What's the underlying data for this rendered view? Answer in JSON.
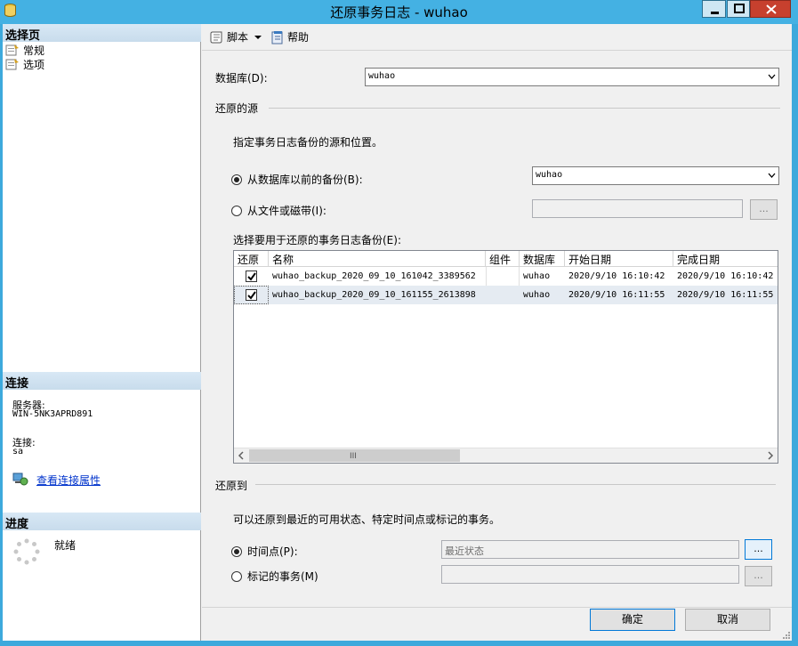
{
  "window": {
    "title": "还原事务日志  -  wuhao",
    "colors": {
      "titlebar": "#44b1e3",
      "close": "#c7402e"
    }
  },
  "left": {
    "select_page_header": "选择页",
    "pages": [
      {
        "label": "常规",
        "icon": "page-settings-icon"
      },
      {
        "label": "选项",
        "icon": "page-settings-icon"
      }
    ],
    "connection_header": "连接",
    "server_label": "服务器:",
    "server_value": "WIN-5NK3APRD891",
    "connection_label": "连接:",
    "connection_value": "sa",
    "view_properties_link": "查看连接属性",
    "progress_header": "进度",
    "progress_status": "就绪"
  },
  "toolbar": {
    "script_label": "脚本",
    "help_label": "帮助"
  },
  "form": {
    "database_label": "数据库(D):",
    "database_value": "wuhao",
    "source_section": "还原的源",
    "source_hint": "指定事务日志备份的源和位置。",
    "from_db_label": "从数据库以前的备份(B):",
    "from_db_value": "wuhao",
    "from_file_label": "从文件或磁带(I):",
    "from_file_value": "",
    "browse_label": "...",
    "select_backups_label": "选择要用于还原的事务日志备份(E):",
    "restore_to_section": "还原到",
    "restore_to_hint": "可以还原到最近的可用状态、特定时间点或标记的事务。",
    "point_in_time_label": "时间点(P):",
    "point_in_time_value": "最近状态",
    "marked_tx_label": "标记的事务(M)",
    "marked_tx_value": "",
    "ok_label": "确定",
    "cancel_label": "取消"
  },
  "grid": {
    "columns": [
      "还原",
      "名称",
      "组件",
      "数据库",
      "开始日期",
      "完成日期"
    ],
    "rows": [
      {
        "restore": true,
        "name": "wuhao_backup_2020_09_10_161042_3389562",
        "component": "",
        "database": "wuhao",
        "start": "2020/9/10 16:10:42",
        "finish": "2020/9/10 16:10:42"
      },
      {
        "restore": true,
        "name": "wuhao_backup_2020_09_10_161155_2613898",
        "component": "",
        "database": "wuhao",
        "start": "2020/9/10 16:11:55",
        "finish": "2020/9/10 16:11:55"
      }
    ],
    "scroll_grip": "III"
  }
}
